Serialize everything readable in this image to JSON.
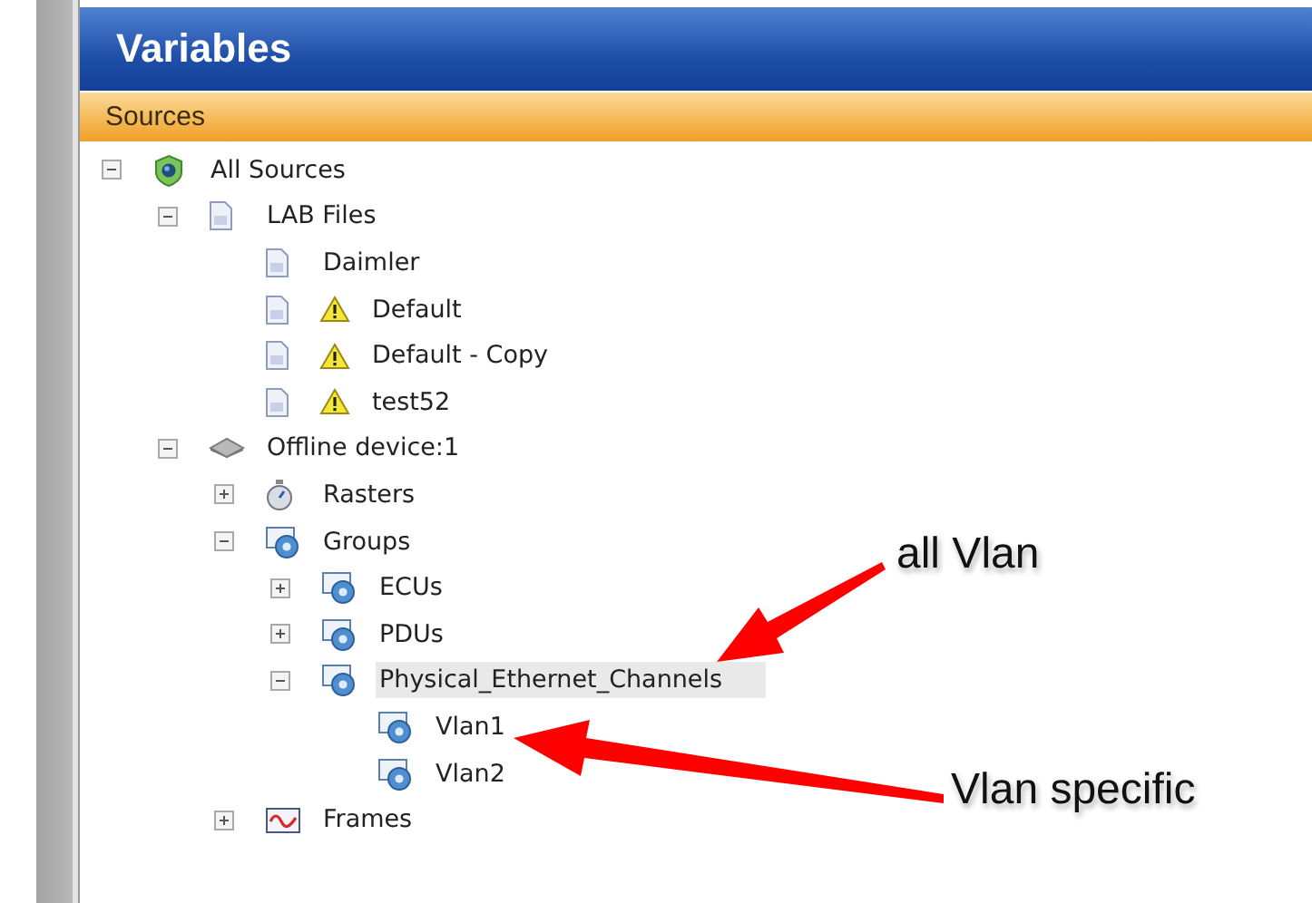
{
  "panel": {
    "title": "Variables",
    "section": "Sources"
  },
  "tree": [
    {
      "label": "All Sources",
      "kind": "shield",
      "expanded": true,
      "selected": false,
      "children": [
        {
          "label": "LAB Files",
          "kind": "document",
          "expanded": true,
          "selected": false,
          "children": [
            {
              "label": "Daimler",
              "kind": "document",
              "warning": false,
              "selected": false
            },
            {
              "label": "Default",
              "kind": "document",
              "warning": true,
              "selected": false
            },
            {
              "label": "Default - Copy",
              "kind": "document",
              "warning": true,
              "selected": false
            },
            {
              "label": "test52",
              "kind": "document",
              "warning": true,
              "selected": false
            }
          ]
        },
        {
          "label": "Offline device:1",
          "kind": "device",
          "expanded": true,
          "selected": false,
          "children": [
            {
              "label": "Rasters",
              "kind": "stopwatch",
              "expanded": false,
              "selected": false
            },
            {
              "label": "Groups",
              "kind": "group",
              "expanded": true,
              "selected": false,
              "children": [
                {
                  "label": "ECUs",
                  "kind": "group",
                  "expanded": false,
                  "selected": false
                },
                {
                  "label": "PDUs",
                  "kind": "group",
                  "expanded": false,
                  "selected": false
                },
                {
                  "label": "Physical_Ethernet_Channels",
                  "kind": "group",
                  "expanded": true,
                  "selected": true,
                  "children": [
                    {
                      "label": "Vlan1",
                      "kind": "group",
                      "selected": false
                    },
                    {
                      "label": "Vlan2",
                      "kind": "group",
                      "selected": false
                    }
                  ]
                }
              ]
            },
            {
              "label": "Frames",
              "kind": "frames",
              "expanded": false,
              "selected": false
            }
          ]
        }
      ]
    }
  ],
  "annotations": [
    {
      "text": "all Vlan"
    },
    {
      "text": "Vlan specific"
    }
  ]
}
